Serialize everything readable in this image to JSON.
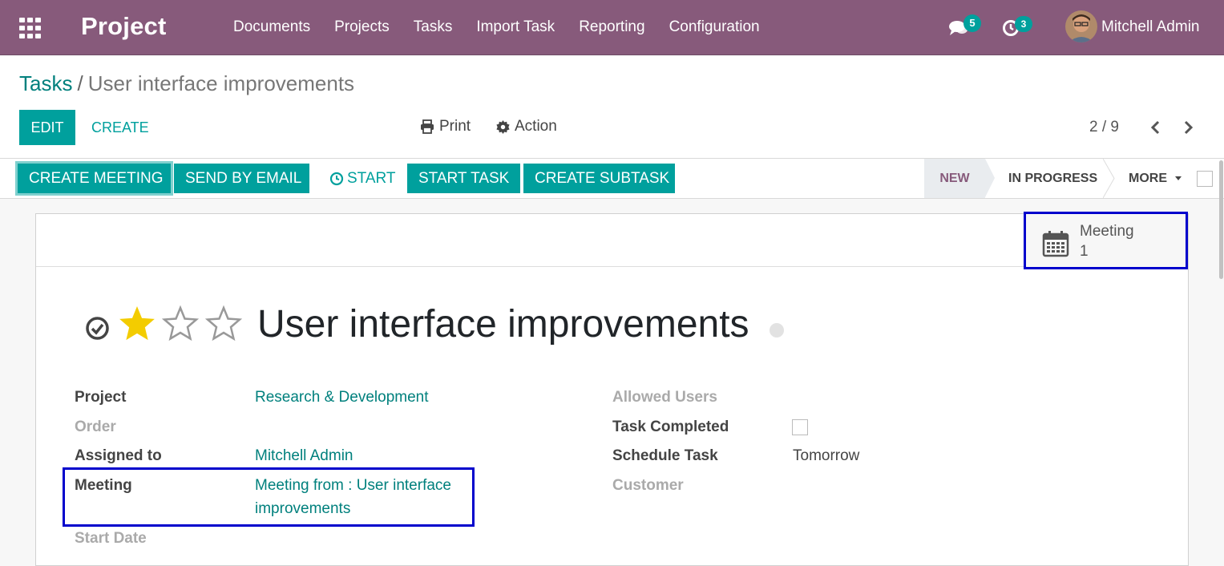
{
  "navbar": {
    "brand": "Project",
    "menu": [
      "Documents",
      "Projects",
      "Tasks",
      "Import Task",
      "Reporting",
      "Configuration"
    ],
    "messages_count": "5",
    "activities_count": "3",
    "user_name": "Mitchell Admin",
    "icons": [
      "apps-grid-icon",
      "chat-bubbles-icon",
      "clock-icon",
      "user-avatar"
    ]
  },
  "breadcrumb": {
    "parent": "Tasks",
    "separator": "/",
    "current": "User interface improvements"
  },
  "control": {
    "edit_label": "EDIT",
    "create_label": "CREATE",
    "print_label": "Print",
    "action_label": "Action",
    "pager": "2 / 9"
  },
  "statusbar": {
    "create_meeting": "CREATE MEETING",
    "send_email": "SEND BY EMAIL",
    "start": "START",
    "start_task": "START TASK",
    "create_subtask": "CREATE SUBTASK",
    "stages": {
      "new": "NEW",
      "in_progress": "IN PROGRESS",
      "more": "MORE"
    }
  },
  "smart_button": {
    "label": "Meeting",
    "value": "1"
  },
  "task": {
    "title": "User interface improvements",
    "priority_stars_filled": 1,
    "priority_stars_total": 3
  },
  "fields": {
    "left": [
      {
        "label": "Project",
        "value": "Research & Development"
      },
      {
        "label": "Order",
        "value": ""
      },
      {
        "label": "Assigned to",
        "value": "Mitchell Admin"
      },
      {
        "label": "Meeting",
        "value_line1": "Meeting from : User interface",
        "value_line2": "improvements"
      },
      {
        "label": "Start Date",
        "value": ""
      }
    ],
    "right": [
      {
        "label": "Allowed Users",
        "value": ""
      },
      {
        "label": "Task Completed",
        "value": ""
      },
      {
        "label": "Schedule Task",
        "value": "Tomorrow"
      },
      {
        "label": "Customer",
        "value": ""
      }
    ]
  },
  "colors": {
    "navbar": "#875a7b",
    "primary": "#00a09d",
    "link": "#00807d",
    "highlight": "#0000cc"
  }
}
